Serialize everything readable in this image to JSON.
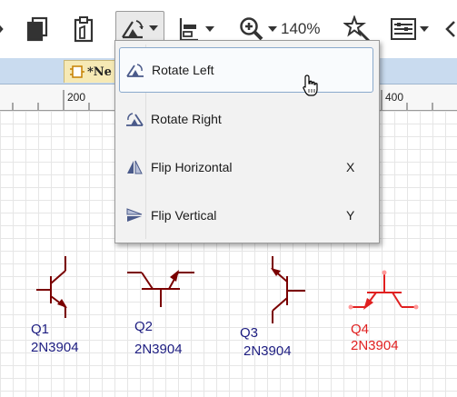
{
  "toolbar": {
    "zoom_level": "140%"
  },
  "tab": {
    "title": "*Ne"
  },
  "ruler": {
    "labels": [
      "200",
      "400"
    ]
  },
  "menu": {
    "items": [
      {
        "label": "Rotate Left",
        "shortcut": ""
      },
      {
        "label": "Rotate Right",
        "shortcut": ""
      },
      {
        "label": "Flip Horizontal",
        "shortcut": "X"
      },
      {
        "label": "Flip Vertical",
        "shortcut": "Y"
      }
    ]
  },
  "parts": [
    {
      "ref": "Q1",
      "value": "2N3904"
    },
    {
      "ref": "Q2",
      "value": "2N3904"
    },
    {
      "ref": "Q3",
      "value": "2N3904"
    },
    {
      "ref": "Q4",
      "value": "2N3904"
    }
  ],
  "colors": {
    "part_normal": "#7a0000",
    "label_normal": "#1c1c80",
    "part_selected": "#e02020",
    "menu_hover_border": "#8aa9cc",
    "tab_strip": "#c9dbef",
    "doc_tab": "#f6e9b5"
  }
}
